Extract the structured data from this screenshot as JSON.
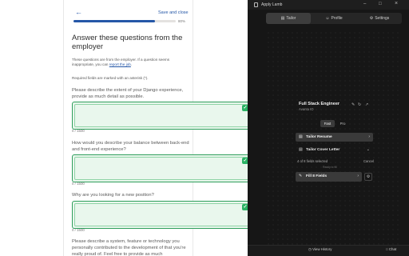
{
  "form": {
    "save_label": "Save and close",
    "progress_text": "80%",
    "progress": 0.8,
    "title": "Answer these questions from the employer",
    "intro_text": "These questions are from the employer. If a question seems inappropriate, you can",
    "intro_link": "report the job",
    "intro_end": ".",
    "required_note": "Required fields are marked with an asterisk (*).",
    "questions": [
      {
        "label": "Please describe the extent of your Django experience, provide as much detail as possible.",
        "count": "0 / 1500"
      },
      {
        "label": "How would you describe your balance between back-end and front-end experience?",
        "count": "0 / 1500"
      },
      {
        "label": "Why are you looking for a new position?",
        "count": "0 / 1500"
      },
      {
        "label": "Please describe a system, feature or technology you personally contributed to the development of that you're really proud of. Feel free to provide as much"
      }
    ]
  },
  "panel": {
    "app_title": "Apply Lamb",
    "tabs": [
      {
        "label": "Tailor",
        "icon": "tailor-icon",
        "active": true
      },
      {
        "label": "Profile",
        "icon": "profile-icon",
        "active": false
      },
      {
        "label": "Settings",
        "icon": "settings-icon",
        "active": false
      }
    ],
    "job": {
      "title": "Full Stack Engineer",
      "company": "Avanta IO"
    },
    "modes": {
      "fast": "Fast",
      "pro": "Pro"
    },
    "tailor_resume": "Tailor Resume",
    "tailor_cover": "Tailor Cover Letter",
    "fields_selected": "4 of 8 fields selected",
    "cancel": "Cancel",
    "ready": "Ready to fill",
    "fill_label": "Fill 8 Fields",
    "view_history": "View History",
    "chat": "Chat"
  },
  "colors": {
    "accent": "#2557a7",
    "success": "#2ab364",
    "panel_bg": "#161616"
  }
}
